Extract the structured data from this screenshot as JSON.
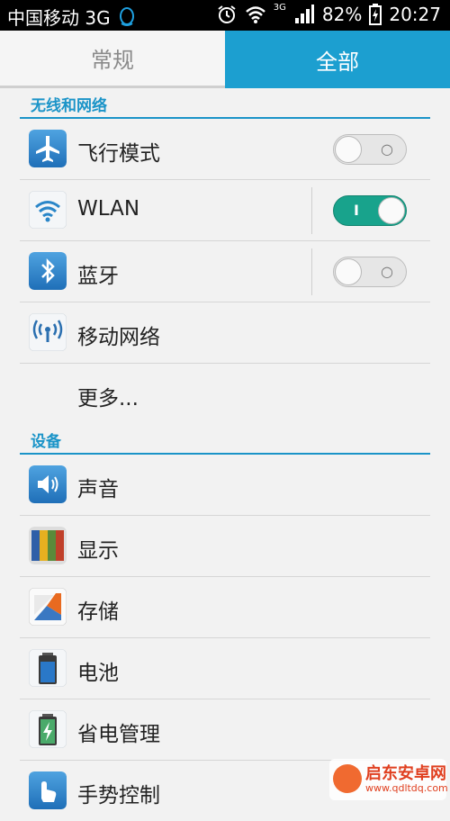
{
  "status_bar": {
    "carrier": "中国移动 3G",
    "battery": "82%",
    "time": "20:27",
    "network": "3G"
  },
  "tabs": [
    {
      "label": "常规",
      "active": false
    },
    {
      "label": "全部",
      "active": true
    }
  ],
  "sections": {
    "wireless": {
      "header": "无线和网络",
      "items": {
        "airplane": {
          "label": "飞行模式",
          "icon": "airplane-icon",
          "toggle": "off"
        },
        "wlan": {
          "label": "WLAN",
          "icon": "wifi-icon",
          "toggle": "on"
        },
        "bluetooth": {
          "label": "蓝牙",
          "icon": "bluetooth-icon",
          "toggle": "off"
        },
        "mobile_network": {
          "label": "移动网络",
          "icon": "antenna-icon"
        },
        "more": {
          "label": "更多..."
        }
      }
    },
    "device": {
      "header": "设备",
      "items": {
        "sound": {
          "label": "声音",
          "icon": "speaker-icon"
        },
        "display": {
          "label": "显示",
          "icon": "display-icon"
        },
        "storage": {
          "label": "存储",
          "icon": "storage-icon"
        },
        "battery": {
          "label": "电池",
          "icon": "battery-icon"
        },
        "power_management": {
          "label": "省电管理",
          "icon": "power-saving-icon"
        },
        "gesture_control": {
          "label": "手势控制",
          "icon": "gesture-icon"
        }
      }
    }
  },
  "colors": {
    "accent": "#1c9fd0",
    "toggle_on": "#18a38c"
  },
  "watermark": {
    "title": "启东安卓网",
    "url": "www.qdltdq.com"
  }
}
